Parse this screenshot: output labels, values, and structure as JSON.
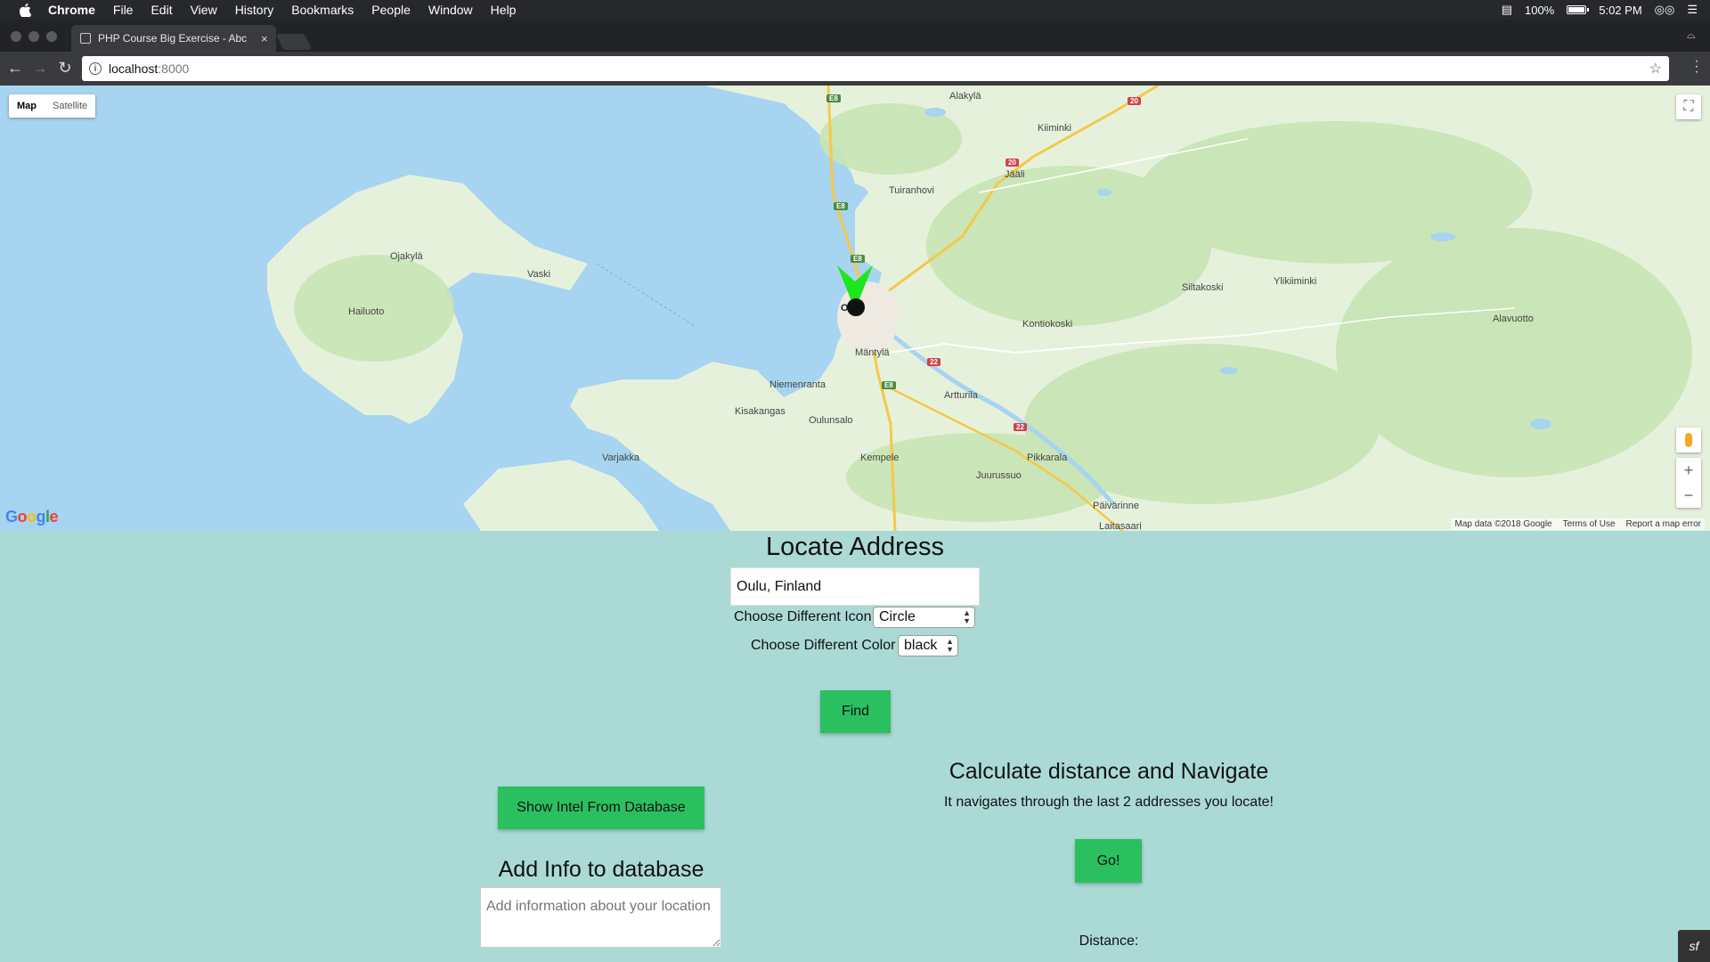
{
  "menubar": {
    "app": "Chrome",
    "items": [
      "File",
      "Edit",
      "View",
      "History",
      "Bookmarks",
      "People",
      "Window",
      "Help"
    ],
    "battery": "100%",
    "time": "5:02 PM"
  },
  "browser": {
    "tab_title": "PHP Course Big Exercise - Abc",
    "tab_close": "×",
    "url_host": "localhost",
    "url_port": ":8000"
  },
  "map": {
    "type_map": "Map",
    "type_satellite": "Satellite",
    "logo": "Google",
    "attribution": [
      "Map data ©2018 Google",
      "Terms of Use",
      "Report a map error"
    ],
    "zoom_in": "+",
    "zoom_out": "−",
    "places": {
      "alakyla": "Alakylä",
      "kiiminki": "Kiiminki",
      "jaali": "Jääli",
      "tuiranhovi": "Tuiranhovi",
      "ojakyla": "Ojakylä",
      "vaski": "Vaski",
      "hailuoto": "Hailuoto",
      "oulu": "Oulu",
      "siltakoski": "Siltakoski",
      "ylikiiminki": "Ylikiiminki",
      "alavuotto": "Alavuotto",
      "kontiokoski": "Kontiokoski",
      "mantyla": "Mäntylä",
      "niemenranta": "Niemenranta",
      "artturila": "Artturila",
      "kisakangas": "Kisakangas",
      "oulunsalo": "Oulunsalo",
      "varjakka": "Varjakka",
      "kempele": "Kempele",
      "pikkarala": "Pikkarala",
      "juurussuo": "Juurussuo",
      "paivarinne": "Päivärinne",
      "laitasaari": "Laitasaari"
    },
    "shields": {
      "e8": "E8",
      "r20": "20",
      "r22": "22"
    }
  },
  "locate": {
    "title": "Locate Address",
    "address_value": "Oulu, Finland",
    "icon_label": "Choose Different Icon",
    "icon_selected": "Circle",
    "color_label": "Choose Different Color",
    "color_selected": "black",
    "find_button": "Find"
  },
  "database": {
    "show_button": "Show Intel From Database",
    "add_title": "Add Info to database",
    "info_placeholder": "Add information about your location"
  },
  "navigate": {
    "title": "Calculate distance and Navigate",
    "subtitle": "It navigates through the last 2 addresses you locate!",
    "go_button": "Go!",
    "distance_label": "Distance:"
  },
  "colors": {
    "page_bg": "#abdad6",
    "button_green": "#2ac060",
    "marker_green": "#1ee61e",
    "water": "#a7d4f0",
    "land": "#e6f1dc"
  }
}
